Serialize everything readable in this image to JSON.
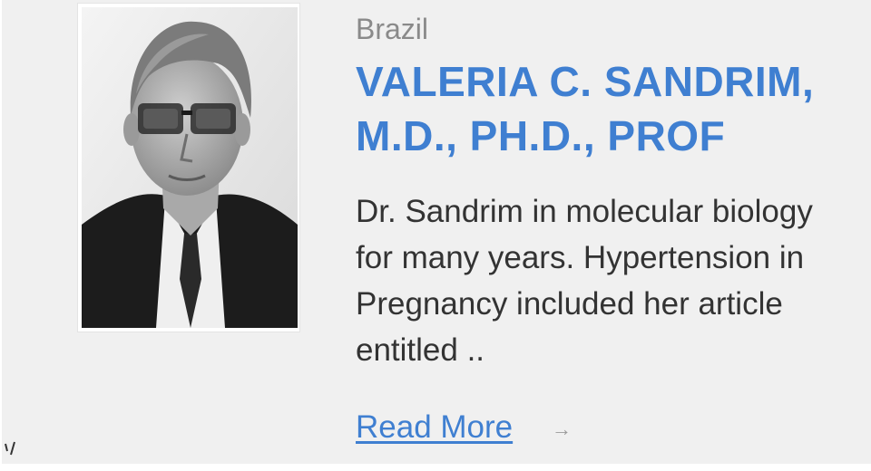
{
  "profile": {
    "country": "Brazil",
    "name_lines": [
      "VALERIA C. SANDRIM,",
      "M.D., PH.D., PROF"
    ],
    "bio_lines": [
      "Dr. Sandrim in molecular biology",
      "for many years. Hypertension in",
      "Pregnancy included her article",
      "entitled .."
    ],
    "read_more_label": "Read More",
    "arrow_glyph": "→"
  },
  "colors": {
    "accent": "#3f7fd1",
    "text": "#333333",
    "muted": "#8a8a8a",
    "panel_background": "#f0f0f0"
  },
  "icons": {
    "read_more_arrow": "arrow-right-icon",
    "profile_photo": "portrait-photo"
  }
}
